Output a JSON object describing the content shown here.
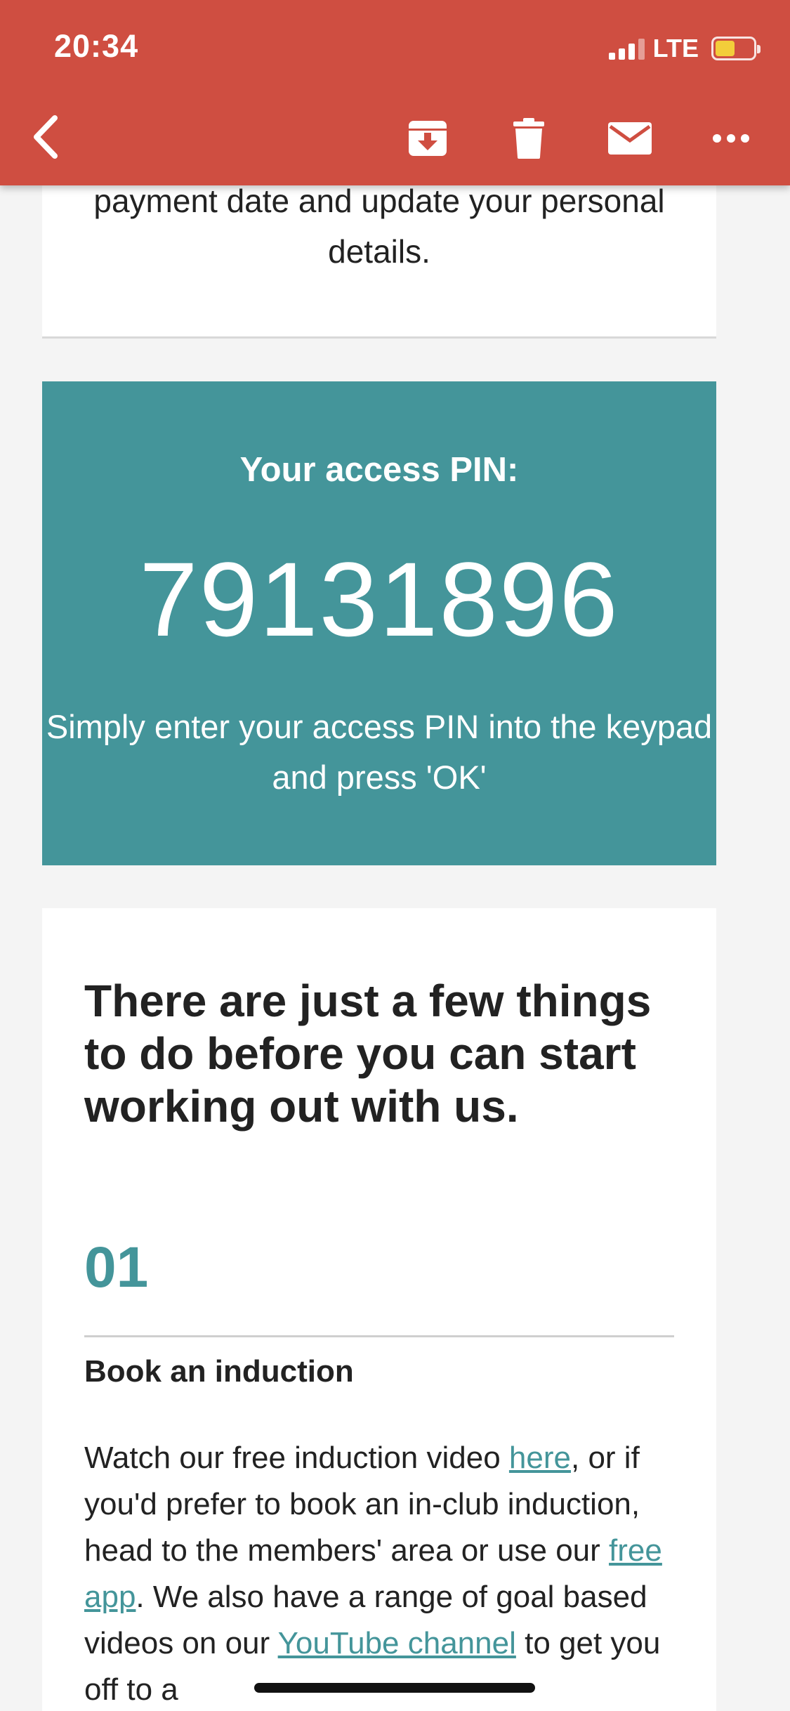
{
  "status_bar": {
    "time": "20:34",
    "network": "LTE",
    "battery_level": 0.46,
    "battery_color": "#f3cd3a"
  },
  "toolbar": {
    "background": "#cf4e41",
    "icons": [
      "back-icon",
      "archive-icon",
      "trash-icon",
      "mail-icon",
      "more-icon"
    ]
  },
  "intro": {
    "text": "payment date and update your personal details."
  },
  "pin": {
    "label": "Your access PIN:",
    "value": "79131896",
    "help": "Simply enter your access PIN into the keypad and press 'OK'",
    "background": "#44959a"
  },
  "steps": {
    "heading": "There are just a few things to do before you can start working out with us.",
    "step1": {
      "number": "01",
      "title": "Book an induction",
      "text_1": "Watch our free induction video ",
      "link_1": "here",
      "text_2": ", or if you'd prefer to book an in-club induction, head to the members' area or use our ",
      "link_2": "free app",
      "text_3": ". We also have a range of goal based videos on our ",
      "link_3": "YouTube channel",
      "text_4": " to get you off to a"
    }
  }
}
